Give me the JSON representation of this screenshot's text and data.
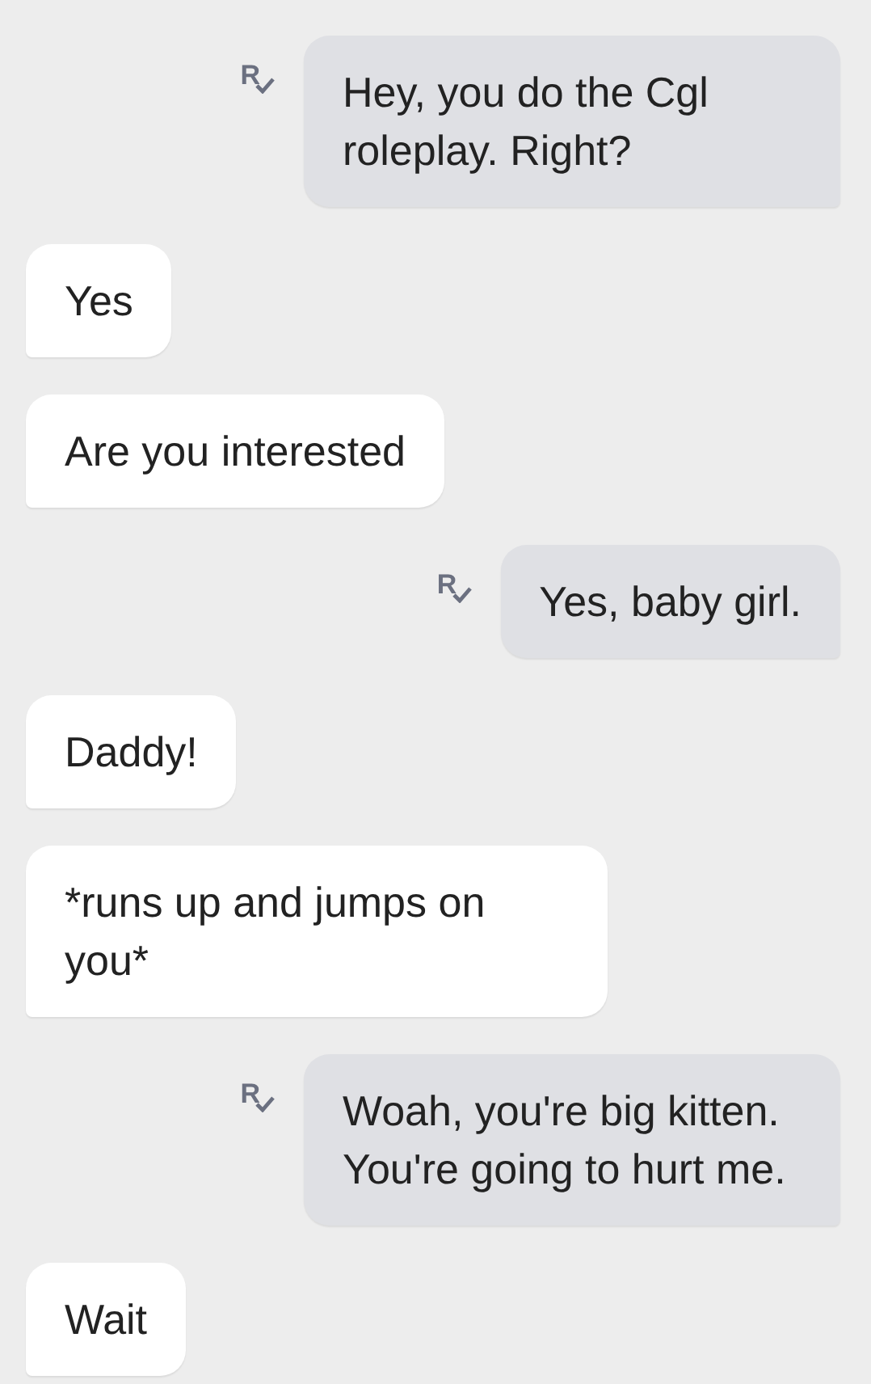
{
  "messages": [
    {
      "kind": "outgoing",
      "text": "Hey, you do the Cgl roleplay. Right?",
      "receipt": "R"
    },
    {
      "kind": "incoming",
      "text": "Yes"
    },
    {
      "kind": "incoming",
      "text": "Are you interested"
    },
    {
      "kind": "outgoing",
      "text": "Yes, baby girl.",
      "receipt": "R"
    },
    {
      "kind": "incoming",
      "text": "Daddy!"
    },
    {
      "kind": "incoming",
      "text": "*runs up and jumps on you*"
    },
    {
      "kind": "outgoing",
      "text": "Woah, you're big kitten. You're going to hurt me.",
      "receipt": "R"
    },
    {
      "kind": "incoming",
      "text": "Wait"
    }
  ]
}
